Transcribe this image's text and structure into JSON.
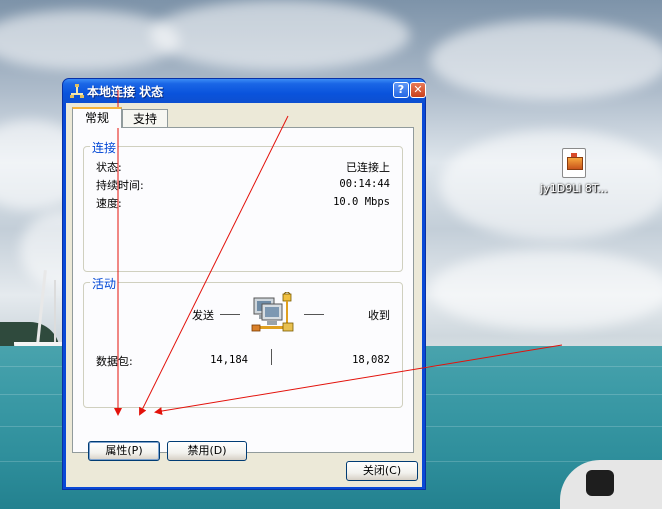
{
  "desktop": {
    "icon_label": "jy1D9Ll 8T..."
  },
  "window": {
    "title": "本地连接 状态",
    "help_glyph": "?",
    "close_glyph": "✕",
    "tabs": [
      {
        "label": "常规",
        "active": true
      },
      {
        "label": "支持",
        "active": false
      }
    ],
    "connection": {
      "legend": "连接",
      "status_label": "状态:",
      "status_value": "已连接上",
      "duration_label": "持续时间:",
      "duration_value": "00:14:44",
      "speed_label": "速度:",
      "speed_value": "10.0 Mbps"
    },
    "activity": {
      "legend": "活动",
      "sent_label": "发送",
      "received_label": "收到",
      "packets_label": "数据包:",
      "packets_sent": "14,184",
      "packets_received": "18,082"
    },
    "buttons": {
      "properties": "属性(P)",
      "disable": "禁用(D)",
      "close": "关闭(C)"
    }
  },
  "annotation_color": "#e3120b",
  "accent_color": "#0046d5"
}
